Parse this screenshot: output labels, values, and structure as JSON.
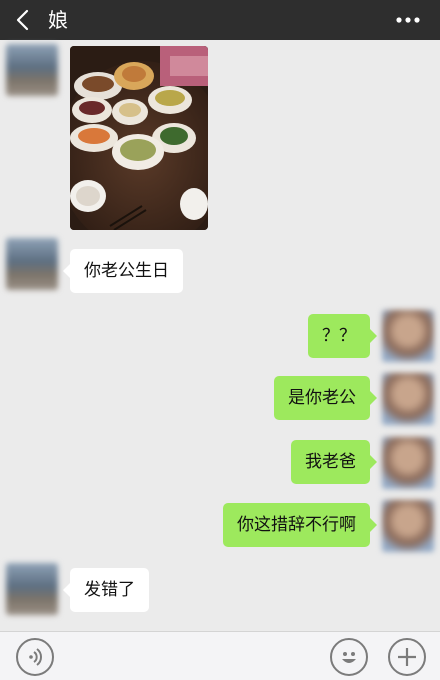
{
  "header": {
    "title": "娘",
    "back_icon": "chevron-left-icon",
    "more_icon": "more-dots-icon"
  },
  "messages": [
    {
      "from": "contact",
      "type": "image",
      "description": "food-photo"
    },
    {
      "from": "contact",
      "type": "text",
      "text": "你老公生日"
    },
    {
      "from": "me",
      "type": "text",
      "text": "？？"
    },
    {
      "from": "me",
      "type": "text",
      "text": "是你老公"
    },
    {
      "from": "me",
      "type": "text",
      "text": "我老爸"
    },
    {
      "from": "me",
      "type": "text",
      "text": "你这措辞不行啊"
    },
    {
      "from": "contact",
      "type": "text",
      "text": "发错了"
    }
  ],
  "input_bar": {
    "voice_icon": "voice-icon",
    "emoji_icon": "emoji-icon",
    "add_icon": "plus-icon"
  },
  "colors": {
    "header_bg": "#2e2e2e",
    "chat_bg": "#ebebeb",
    "incoming_bubble": "#ffffff",
    "outgoing_bubble": "#9de95d"
  }
}
